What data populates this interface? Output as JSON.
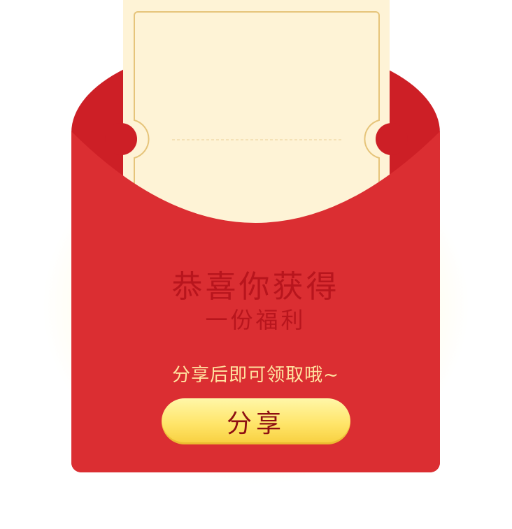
{
  "red_packet": {
    "title": "恭喜你获得",
    "subtitle": "一份福利",
    "hint": "分享后即可领取哦~",
    "share_label": "分享"
  },
  "colors": {
    "envelope_red": "#db2e32",
    "envelope_dark_red": "#cd1f26",
    "ticket": "#fef3d6",
    "title_text": "#b8151d",
    "hint_text": "#ffe2a0",
    "button_yellow": "#ffe56a",
    "button_text": "#8e0f12"
  }
}
